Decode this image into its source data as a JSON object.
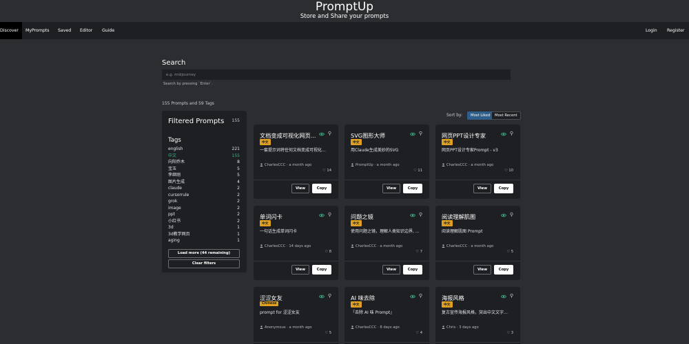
{
  "header": {
    "title": "PromptUp",
    "subtitle": "Store and Share your prompts"
  },
  "nav": {
    "left": [
      "Discover",
      "MyPrompts",
      "Saved",
      "Editor",
      "Guide"
    ],
    "right": [
      "Login",
      "Register"
    ]
  },
  "search": {
    "label": "Search",
    "placeholder": "e.g. midjourney",
    "hint": "Search by pressing `Enter`."
  },
  "counts_text": "155 Prompts and 59 Tags",
  "sort": {
    "label": "Sort by:",
    "options": [
      "Most Liked",
      "Most Recent"
    ],
    "active": "Most Liked"
  },
  "sidebar": {
    "title": "Filtered Prompts",
    "count": "155",
    "tags_heading": "Tags",
    "tags": [
      {
        "name": "english",
        "count": "221"
      },
      {
        "name": "中文",
        "count": "155",
        "selected": true
      },
      {
        "name": "向阳乔木",
        "count": "8"
      },
      {
        "name": "宝玉",
        "count": "5"
      },
      {
        "name": "李继刚",
        "count": "5"
      },
      {
        "name": "图片生成",
        "count": "4"
      },
      {
        "name": "claude",
        "count": "2"
      },
      {
        "name": "cursorrule",
        "count": "2"
      },
      {
        "name": "grok",
        "count": "2"
      },
      {
        "name": "image",
        "count": "2"
      },
      {
        "name": "ppt",
        "count": "2"
      },
      {
        "name": "小红书",
        "count": "2"
      },
      {
        "name": "3d",
        "count": "1"
      },
      {
        "name": "3d教学网页",
        "count": "1"
      },
      {
        "name": "aging",
        "count": "1"
      }
    ],
    "load_more": "Load more (44 remaining)",
    "clear": "Clear filters"
  },
  "colors": {
    "accent": "#3bb58a",
    "badge": "#e0a020",
    "sort_active": "#2f5e8a"
  },
  "cards": [
    {
      "title": "文档变成可视化网页...",
      "badge": "中文",
      "desc": "一套提示词将任何文档变成可视化...",
      "meta": "CharlesCCC · a month ago",
      "likes": "14"
    },
    {
      "title": "SVG图形大师",
      "badge": "中文",
      "desc": "用Claude生成美妙的SVG",
      "meta": "PromptUp · a month ago",
      "likes": "11"
    },
    {
      "title": "网页PPT设计专家",
      "badge": "中文",
      "desc": "网页PPT设计专家Prompt - v3",
      "meta": "CharlesCCC · a month ago",
      "likes": "10"
    },
    {
      "title": "单词闪卡",
      "badge": "中文",
      "desc": "一句话生成单词闪卡",
      "meta": "CharlesCCC · 14 days ago",
      "likes": "8"
    },
    {
      "title": "问题之镜",
      "badge": "中文",
      "desc": "使用问题之镜，理解人类知识边界, ...",
      "meta": "CharlesCCC · a month ago",
      "likes": "7"
    },
    {
      "title": "阅读理解肌图",
      "badge": "中文",
      "desc": "阅读理解肌图 Prompt",
      "meta": "CharlesCCC · a month ago",
      "likes": "5"
    },
    {
      "title": "涩涩女友",
      "badge": "Chinese",
      "desc": "prompt for 涩涩女友",
      "meta": "Anonymous · a month ago",
      "likes": "5"
    },
    {
      "title": "AI 味去除",
      "badge": "中文",
      "desc": "「去除 AI 味 Prompt」",
      "meta": "CharlesCCC · 8 days ago",
      "likes": "4"
    },
    {
      "title": "海报风格",
      "badge": "中文",
      "desc": "复古宣传海报风格，突出中文文字...",
      "meta": "Chris · 3 days ago",
      "likes": "3"
    }
  ],
  "card_buttons": {
    "view": "View",
    "copy": "Copy"
  }
}
